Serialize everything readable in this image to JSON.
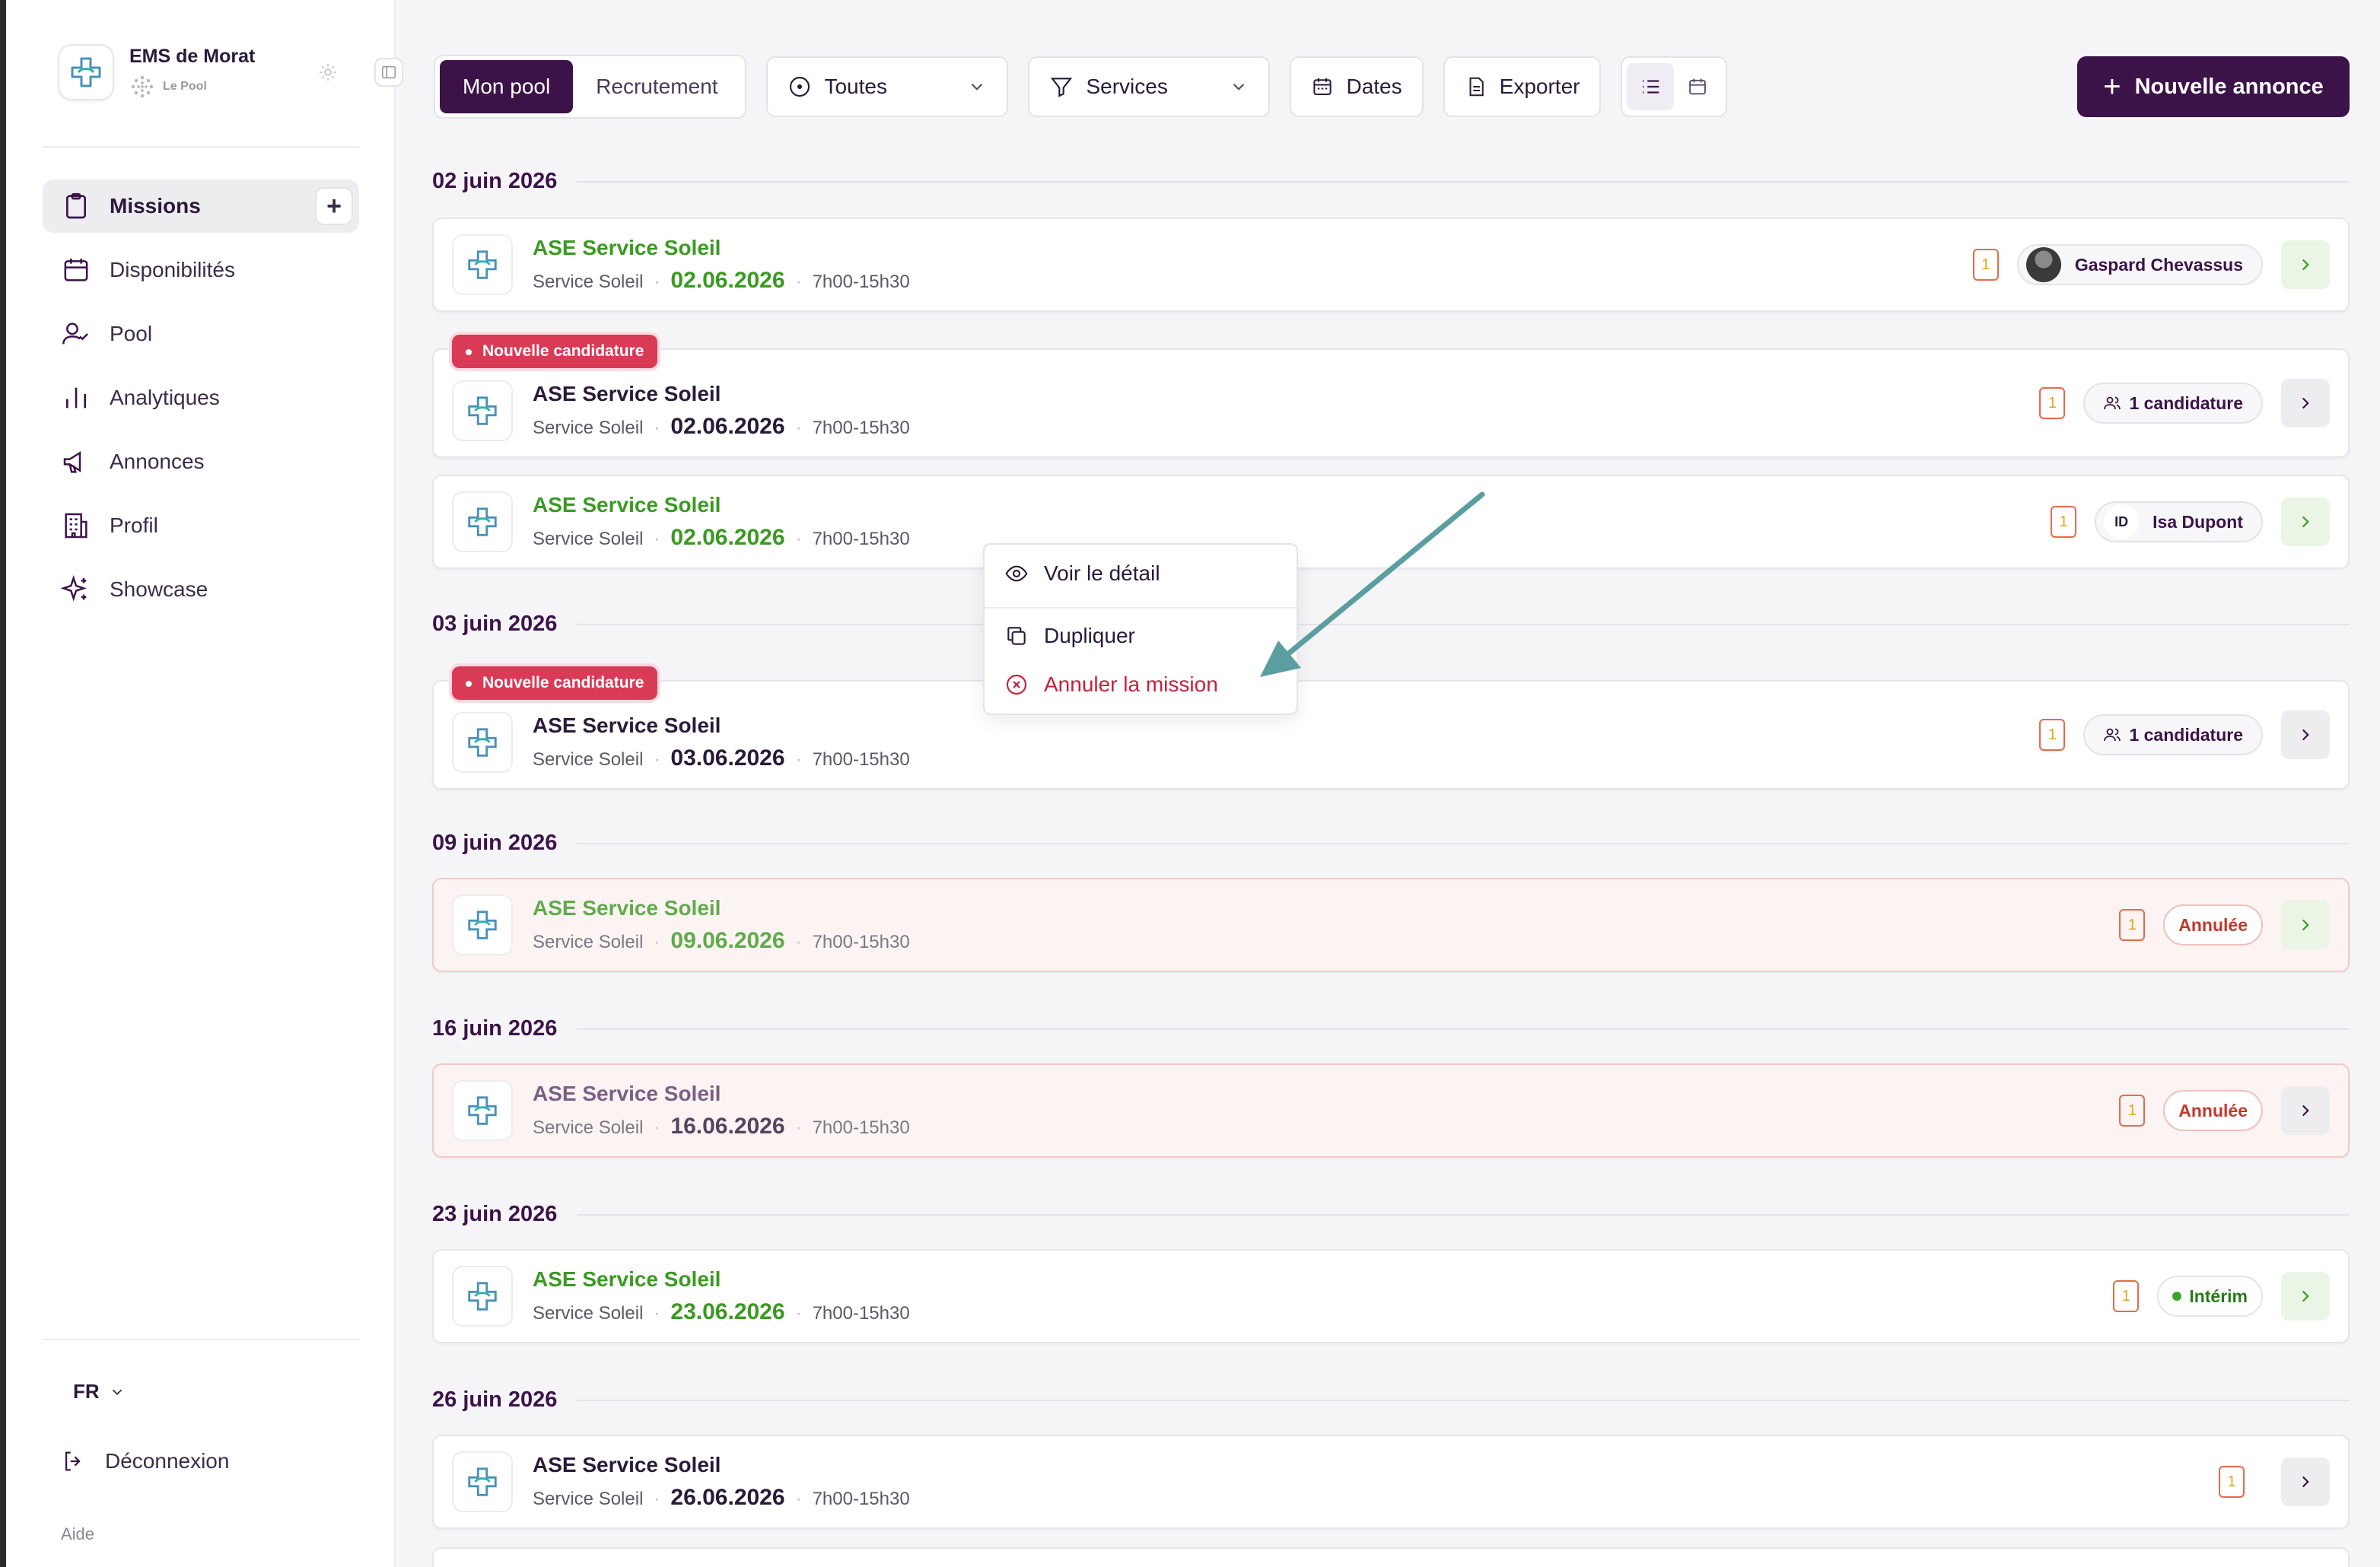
{
  "sidebar": {
    "brand_name": "EMS de Morat",
    "brand_sub": "Le Pool",
    "items": [
      {
        "label": "Missions",
        "icon": "clipboard-icon"
      },
      {
        "label": "Disponibilités",
        "icon": "calendar-icon"
      },
      {
        "label": "Pool",
        "icon": "user-check-icon"
      },
      {
        "label": "Analytiques",
        "icon": "bar-chart-icon"
      },
      {
        "label": "Annonces",
        "icon": "megaphone-icon"
      },
      {
        "label": "Profil",
        "icon": "building-icon"
      },
      {
        "label": "Showcase",
        "icon": "sparkles-icon"
      }
    ],
    "add_label": "+",
    "language": "FR",
    "logout": "Déconnexion",
    "help": "Aide"
  },
  "toolbar": {
    "tabs": [
      "Mon pool",
      "Recrutement"
    ],
    "status_filter": "Toutes",
    "services_filter": "Services",
    "dates": "Dates",
    "export": "Exporter",
    "new_button": "Nouvelle annonce"
  },
  "days": [
    {
      "label": "02 juin 2026"
    },
    {
      "label": "03 juin 2026"
    },
    {
      "label": "09 juin 2026"
    },
    {
      "label": "16 juin 2026"
    },
    {
      "label": "23 juin 2026"
    },
    {
      "label": "26 juin 2026"
    }
  ],
  "missions": [
    {
      "title": "ASE Service Soleil",
      "service": "Service Soleil",
      "date": "02.06.2026",
      "time": "7h00-15h30",
      "count": "1",
      "pill": "Gaspard Chevassus"
    },
    {
      "badge": "Nouvelle candidature",
      "title": "ASE Service Soleil",
      "service": "Service Soleil",
      "date": "02.06.2026",
      "time": "7h00-15h30",
      "count": "1",
      "pill": "1 candidature"
    },
    {
      "title": "ASE Service Soleil",
      "service": "Service Soleil",
      "date": "02.06.2026",
      "time": "7h00-15h30",
      "count": "1",
      "initials": "ID",
      "pill": "Isa Dupont"
    },
    {
      "badge": "Nouvelle candidature",
      "title": "ASE Service Soleil",
      "service": "Service Soleil",
      "date": "03.06.2026",
      "time": "7h00-15h30",
      "count": "1",
      "pill": "1 candidature"
    },
    {
      "title": "ASE Service Soleil",
      "service": "Service Soleil",
      "date": "09.06.2026",
      "time": "7h00-15h30",
      "count": "1",
      "pill": "Annulée"
    },
    {
      "title": "ASE Service Soleil",
      "service": "Service Soleil",
      "date": "16.06.2026",
      "time": "7h00-15h30",
      "count": "1",
      "pill": "Annulée"
    },
    {
      "title": "ASE Service Soleil",
      "service": "Service Soleil",
      "date": "23.06.2026",
      "time": "7h00-15h30",
      "count": "1",
      "pill": "Intérim"
    },
    {
      "title": "ASE Service Soleil",
      "service": "Service Soleil",
      "date": "26.06.2026",
      "time": "7h00-15h30",
      "count": "1"
    }
  ],
  "context_menu": {
    "view": "Voir le détail",
    "duplicate": "Dupliquer",
    "cancel": "Annuler la mission"
  },
  "colors": {
    "primary": "#3c1349",
    "green": "#3a9a22",
    "danger": "#c8203a",
    "badge_red": "#d93a56",
    "arrow_teal": "#5a9ea0"
  }
}
